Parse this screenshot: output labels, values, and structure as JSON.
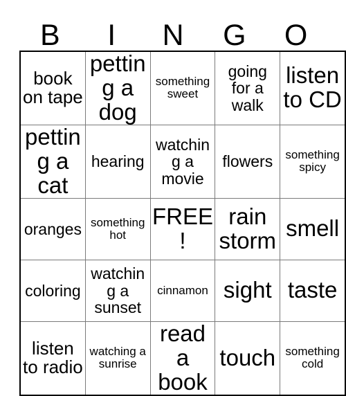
{
  "card": {
    "title": "BINGO",
    "header_letters": [
      "B",
      "I",
      "N",
      "G",
      "O"
    ],
    "free_space_label": "FREE!",
    "colors": {
      "background": "#ffffff",
      "text": "#000000",
      "inner_grid_line": "#7a7a7a",
      "outer_border": "#000000"
    },
    "rows": [
      [
        {
          "text": "book on tape",
          "size": "lg"
        },
        {
          "text": "petting a dog",
          "size": "xl"
        },
        {
          "text": "something sweet",
          "size": "sm"
        },
        {
          "text": "going for a walk",
          "size": "md"
        },
        {
          "text": "listen to CD",
          "size": "xl"
        }
      ],
      [
        {
          "text": "petting a cat",
          "size": "xl"
        },
        {
          "text": "hearing",
          "size": "md"
        },
        {
          "text": "watching a movie",
          "size": "md"
        },
        {
          "text": "flowers",
          "size": "md"
        },
        {
          "text": "something spicy",
          "size": "sm"
        }
      ],
      [
        {
          "text": "oranges",
          "size": "md"
        },
        {
          "text": "something hot",
          "size": "sm"
        },
        {
          "text": "FREE!",
          "size": "xl"
        },
        {
          "text": "rain storm",
          "size": "xl"
        },
        {
          "text": "smell",
          "size": "xl"
        }
      ],
      [
        {
          "text": "coloring",
          "size": "md"
        },
        {
          "text": "watching a sunset",
          "size": "md"
        },
        {
          "text": "cinnamon",
          "size": "sm"
        },
        {
          "text": "sight",
          "size": "xl"
        },
        {
          "text": "taste",
          "size": "xl"
        }
      ],
      [
        {
          "text": "listen to radio",
          "size": "lg"
        },
        {
          "text": "watching a sunrise",
          "size": "sm"
        },
        {
          "text": "read a book",
          "size": "xl"
        },
        {
          "text": "touch",
          "size": "xl"
        },
        {
          "text": "something cold",
          "size": "sm"
        }
      ]
    ]
  }
}
